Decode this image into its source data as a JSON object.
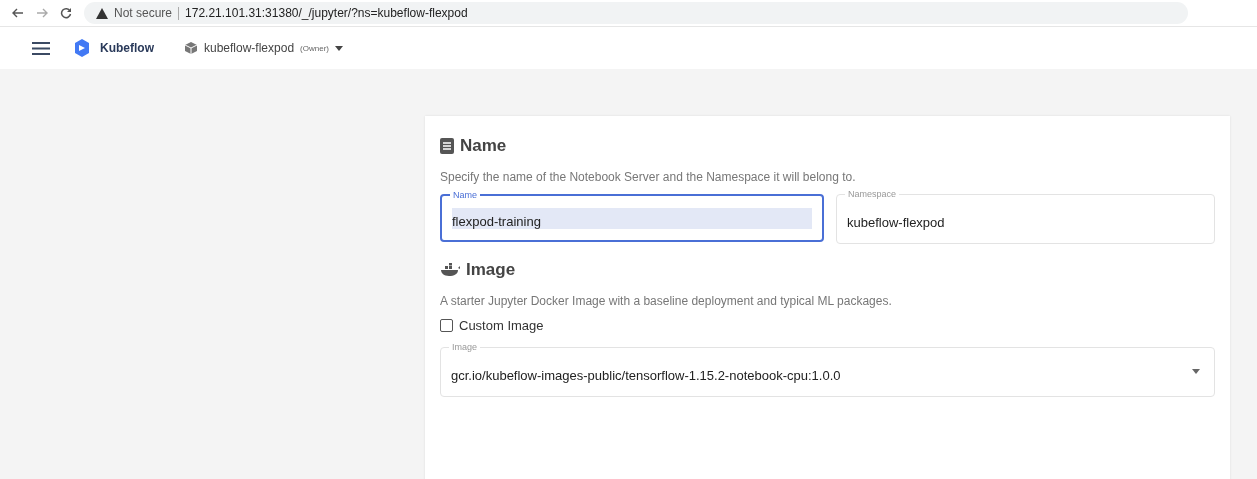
{
  "browser": {
    "security": "Not secure",
    "url": "172.21.101.31:31380/_/jupyter/?ns=kubeflow-flexpod"
  },
  "header": {
    "brand": "Kubeflow",
    "namespace": "kubeflow-flexpod",
    "role": "(Owner)"
  },
  "sections": [
    {
      "kind": "name",
      "title": "Name",
      "description": "Specify the name of the Notebook Server and the Namespace it will belong to.",
      "fields": [
        {
          "label": "Name",
          "value": "flexpod-training",
          "focused": true
        },
        {
          "label": "Namespace",
          "value": "kubeflow-flexpod",
          "focused": false
        }
      ]
    },
    {
      "kind": "image",
      "title": "Image",
      "description": "A starter Jupyter Docker Image with a baseline deployment and typical ML packages.",
      "checkbox": {
        "label": "Custom Image",
        "checked": false
      },
      "select": {
        "label": "Image",
        "value": "gcr.io/kubeflow-images-public/tensorflow-1.15.2-notebook-cpu:1.0.0"
      }
    }
  ]
}
